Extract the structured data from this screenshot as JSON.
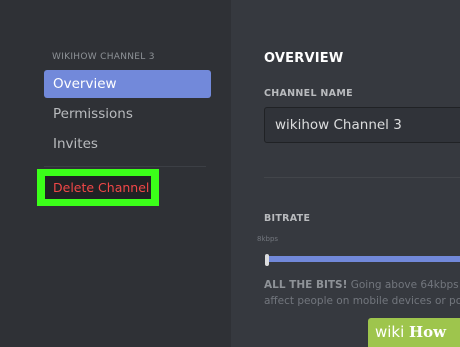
{
  "sidebar": {
    "section_label": "WIKIHOW CHANNEL 3",
    "items": [
      {
        "label": "Overview",
        "active": true
      },
      {
        "label": "Permissions",
        "active": false
      },
      {
        "label": "Invites",
        "active": false
      }
    ],
    "delete_label": "Delete Channel"
  },
  "main": {
    "title": "OVERVIEW",
    "channel_name_label": "CHANNEL NAME",
    "channel_name_value": "wikihow Channel 3",
    "bitrate_label": "BITRATE",
    "bitrate_tick": "8kbps",
    "bitrate_fill_fraction": 1.0,
    "hint_bold": "ALL THE BITS!",
    "hint_line1": " Going above 64kbps is",
    "hint_line2": "affect people on mobile devices or poo"
  },
  "watermark": {
    "wiki": "wiki",
    "how": "How"
  },
  "colors": {
    "accent": "#7289da",
    "danger": "#f04747",
    "highlight": "#3bff19",
    "sidebar_bg": "#2f3136",
    "main_bg": "#36393f"
  }
}
